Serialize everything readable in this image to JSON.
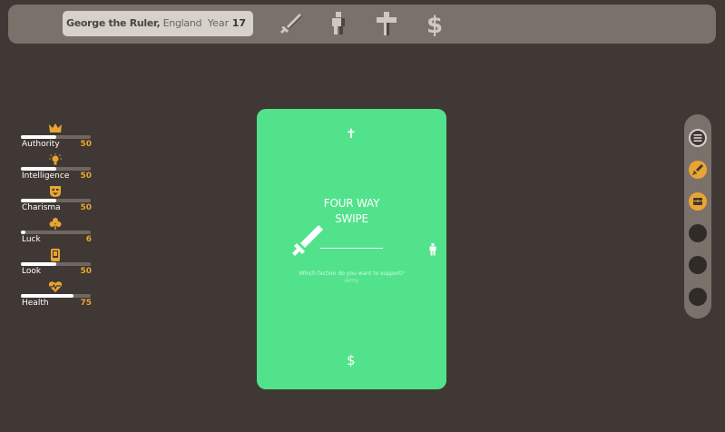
{
  "topbar": {
    "ruler_name": "George the Ruler,",
    "ruler_country": " England",
    "year_label": "Year ",
    "year_value": "17",
    "icons": [
      "sword-icon",
      "person-icon",
      "cross-icon",
      "dollar-icon"
    ]
  },
  "stats": [
    {
      "name": "Authority",
      "value": "50",
      "fraction": 0.5,
      "icon": "crown-icon"
    },
    {
      "name": "Intelligence",
      "value": "50",
      "fraction": 0.5,
      "icon": "lightbulb-icon"
    },
    {
      "name": "Charisma",
      "value": "50",
      "fraction": 0.5,
      "icon": "mask-icon"
    },
    {
      "name": "Luck",
      "value": "6",
      "fraction": 0.06,
      "icon": "clover-icon"
    },
    {
      "name": "Look",
      "value": "50",
      "fraction": 0.5,
      "icon": "mirror-icon"
    },
    {
      "name": "Health",
      "value": "75",
      "fraction": 0.75,
      "icon": "heart-icon"
    }
  ],
  "card": {
    "title_line1": "FOUR WAY",
    "title_line2": "SWIPE",
    "question": "Which faction do you want to support?",
    "overlay_text": "Army",
    "top_glyph": "✝",
    "bottom_glyph": "$",
    "color": "#53e28c"
  },
  "side_panel": {
    "slots": [
      "menu-icon",
      "sword-badge-icon",
      "chest-badge-icon",
      "empty-slot",
      "empty-slot",
      "empty-slot"
    ]
  },
  "colors": {
    "background": "#3f3834",
    "bar": "#7b716b",
    "accent": "#e9a531",
    "card": "#53e28c"
  }
}
